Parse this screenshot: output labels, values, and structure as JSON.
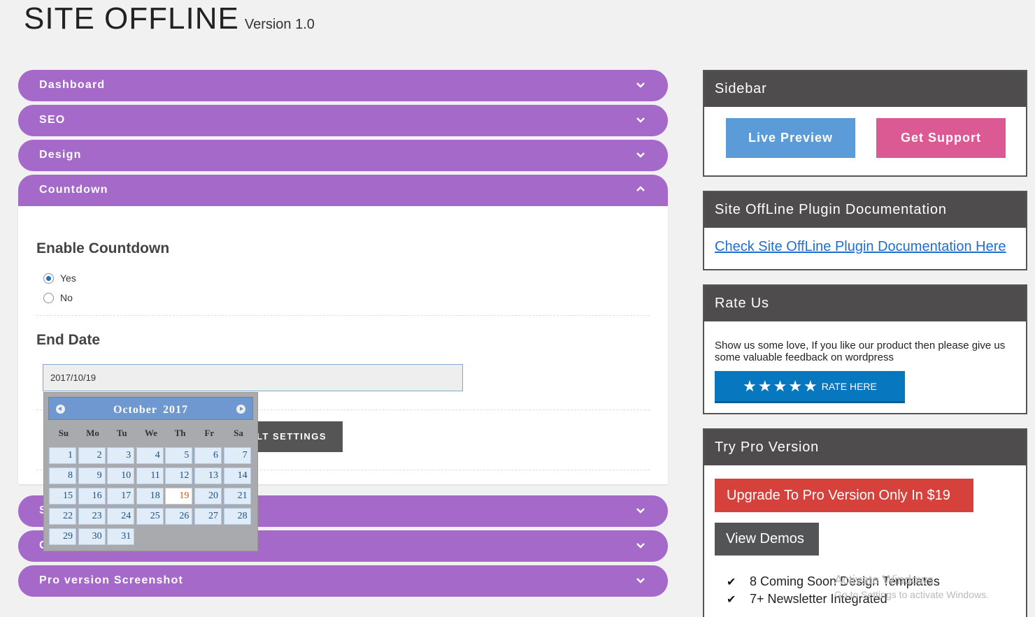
{
  "header": {
    "title": "SITE OFFLINE",
    "version": "Version 1.0"
  },
  "accordion": {
    "items": [
      {
        "label": "Dashboard"
      },
      {
        "label": "SEO"
      },
      {
        "label": "Design"
      },
      {
        "label": "Countdown"
      },
      {
        "label": "S"
      },
      {
        "label": "C"
      },
      {
        "label": "Pro version Screenshot"
      }
    ]
  },
  "countdown": {
    "enable_heading": "Enable Countdown",
    "options": [
      "Yes",
      "No"
    ],
    "selected": "Yes",
    "end_date_heading": "End Date",
    "end_date_value": "2017/10/19",
    "reset_button": "LT SETTINGS"
  },
  "calendar": {
    "month": "October",
    "year": "2017",
    "weekdays": [
      "Su",
      "Mo",
      "Tu",
      "We",
      "Th",
      "Fr",
      "Sa"
    ],
    "days": [
      "1",
      "2",
      "3",
      "4",
      "5",
      "6",
      "7",
      "8",
      "9",
      "10",
      "11",
      "12",
      "13",
      "14",
      "15",
      "16",
      "17",
      "18",
      "19",
      "20",
      "21",
      "22",
      "23",
      "24",
      "25",
      "26",
      "27",
      "28",
      "29",
      "30",
      "31"
    ],
    "today": "19"
  },
  "sidebar": {
    "title": "Sidebar",
    "live_preview": "Live Preview",
    "get_support": "Get Support"
  },
  "docs": {
    "title": "Site OffLine Plugin Documentation",
    "link": "Check Site OffLine Plugin Documentation Here"
  },
  "rate": {
    "title": "Rate Us",
    "text": "Show us some love, If you like our product then please give us some valuable feedback on wordpress",
    "stars": "★★★★★",
    "button": "RATE HERE"
  },
  "pro": {
    "title": "Try Pro Version",
    "upgrade": "Upgrade To Pro Version Only In $19",
    "demos": "View Demos",
    "features": [
      "8 Coming Soon Design Templates",
      "7+ Newsletter Integrated"
    ]
  },
  "watermark": {
    "line1": "Activate Windows",
    "line2": "Go to Settings to activate Windows."
  },
  "colors": {
    "accordion": "#a569c9",
    "box_header": "#4e4c4d",
    "live_preview": "#5b9bd7",
    "get_support": "#db5a93",
    "upgrade": "#d6413b"
  }
}
